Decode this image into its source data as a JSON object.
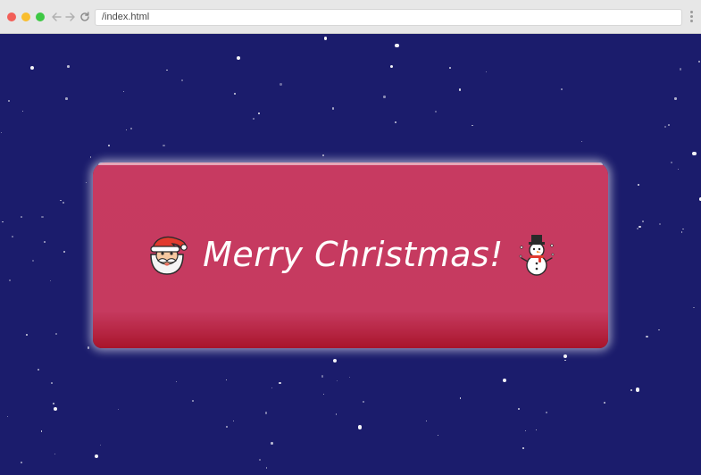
{
  "browser": {
    "url": "/index.html"
  },
  "card": {
    "greeting": "Merry Christmas!",
    "left_emoji": "santa-claus-icon",
    "right_emoji": "snowman-icon"
  },
  "colors": {
    "background": "#1b1c6c",
    "card": "#c73a61",
    "text": "#ffffff"
  }
}
